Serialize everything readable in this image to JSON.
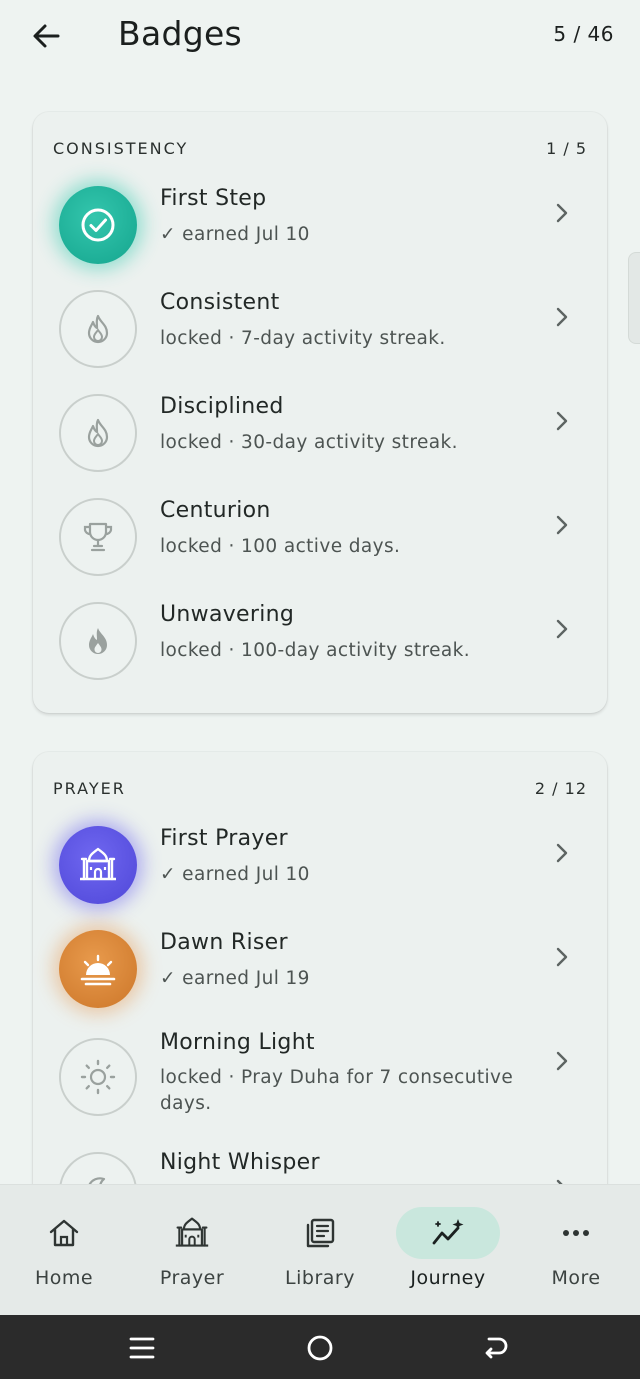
{
  "header": {
    "title": "Badges",
    "count": "5 / 46"
  },
  "categories": [
    {
      "name": "CONSISTENCY",
      "count": "1 / 5",
      "badges": [
        {
          "title": "First Step",
          "subtitle": "✓ earned Jul 10",
          "icon": "check-circle-icon",
          "state": "earned",
          "color": "#1fb39b"
        },
        {
          "title": "Consistent",
          "subtitle": "locked · 7-day activity streak.",
          "icon": "flame-outline-icon",
          "state": "locked"
        },
        {
          "title": "Disciplined",
          "subtitle": "locked · 30-day activity streak.",
          "icon": "flame-outline-icon",
          "state": "locked"
        },
        {
          "title": "Centurion",
          "subtitle": "locked · 100 active days.",
          "icon": "trophy-icon",
          "state": "locked"
        },
        {
          "title": "Unwavering",
          "subtitle": "locked · 100-day activity streak.",
          "icon": "flame-filled-icon",
          "state": "locked"
        }
      ]
    },
    {
      "name": "PRAYER",
      "count": "2 / 12",
      "badges": [
        {
          "title": "First Prayer",
          "subtitle": "✓ earned Jul 10",
          "icon": "mosque-icon",
          "state": "earned",
          "color": "#5a52e3"
        },
        {
          "title": "Dawn Riser",
          "subtitle": "✓ earned Jul 19",
          "icon": "sunrise-icon",
          "state": "earned",
          "color": "#d8832f"
        },
        {
          "title": "Morning Light",
          "subtitle": "locked · Pray Duha for 7 consecutive days.",
          "icon": "sun-icon",
          "state": "locked"
        },
        {
          "title": "Night Whisper",
          "subtitle": "",
          "icon": "moon-icon",
          "state": "locked"
        }
      ]
    }
  ],
  "nav": {
    "items": [
      {
        "label": "Home",
        "icon": "home-icon"
      },
      {
        "label": "Prayer",
        "icon": "mosque-icon"
      },
      {
        "label": "Library",
        "icon": "library-icon"
      },
      {
        "label": "Journey",
        "icon": "journey-icon",
        "active": true
      },
      {
        "label": "More",
        "icon": "more-icon"
      }
    ]
  },
  "system_nav": [
    "recents-icon",
    "home-circle-icon",
    "back-icon"
  ],
  "colors": {
    "accent": "#c9e7dd",
    "background": "#eef3f1"
  }
}
